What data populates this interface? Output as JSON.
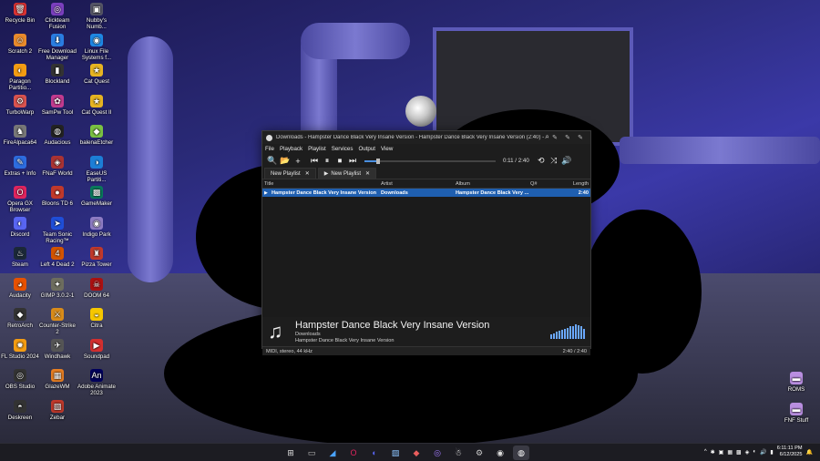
{
  "desktop": {
    "icons": [
      {
        "label": "Recycle Bin",
        "glyph": "🗑",
        "color": "#d33"
      },
      {
        "label": "Clickteam Fusion",
        "glyph": "◎",
        "color": "#7b3fbf"
      },
      {
        "label": "Nubby's Numb...",
        "glyph": "▣",
        "color": "#556"
      },
      {
        "label": "Scratch 2",
        "glyph": "☺",
        "color": "#e88a2c"
      },
      {
        "label": "Free Download Manager",
        "glyph": "⬇",
        "color": "#2a7de1"
      },
      {
        "label": "Linux File Systems f...",
        "glyph": "◉",
        "color": "#1e88e5"
      },
      {
        "label": "Paragon Partitio...",
        "glyph": "◐",
        "color": "#f39c12"
      },
      {
        "label": "Blockland",
        "glyph": "▮",
        "color": "#333"
      },
      {
        "label": "Cat Quest",
        "glyph": "★",
        "color": "#e6b422"
      },
      {
        "label": "TurboWarp",
        "glyph": "⚙",
        "color": "#d9534f"
      },
      {
        "label": "SamPw Tool",
        "glyph": "✿",
        "color": "#c23b8f"
      },
      {
        "label": "Cat Quest II",
        "glyph": "★",
        "color": "#e6b422"
      },
      {
        "label": "FireAlpaca64",
        "glyph": "♞",
        "color": "#777"
      },
      {
        "label": "Audacious",
        "glyph": "◍",
        "color": "#222"
      },
      {
        "label": "balenaEtcher",
        "glyph": "◆",
        "color": "#7ac142"
      },
      {
        "label": "Extras + Info",
        "glyph": "✎",
        "color": "#2d6cdf"
      },
      {
        "label": "FNaF World",
        "glyph": "◈",
        "color": "#a33"
      },
      {
        "label": "EaseUS Partiti...",
        "glyph": "◑",
        "color": "#1c7ed6"
      },
      {
        "label": "Opera GX Browser",
        "glyph": "O",
        "color": "#e0245e"
      },
      {
        "label": "Bloons TD 6",
        "glyph": "●",
        "color": "#c0392b"
      },
      {
        "label": "GameMaker",
        "glyph": "▩",
        "color": "#0a7a5c"
      },
      {
        "label": "Discord",
        "glyph": "◐",
        "color": "#5865f2"
      },
      {
        "label": "Team Sonic Racing™",
        "glyph": "➤",
        "color": "#1f4ed8"
      },
      {
        "label": "Indigo Park",
        "glyph": "◉",
        "color": "#8e7cc3"
      },
      {
        "label": "Steam",
        "glyph": "♨",
        "color": "#1b2838"
      },
      {
        "label": "Left 4 Dead 2",
        "glyph": "4",
        "color": "#d35400"
      },
      {
        "label": "Pizza Tower",
        "glyph": "♜",
        "color": "#c0392b"
      },
      {
        "label": "Audacity",
        "glyph": "◕",
        "color": "#e65100"
      },
      {
        "label": "GIMP 3.0.2-1",
        "glyph": "✦",
        "color": "#6d6d5e"
      },
      {
        "label": "DOOM 64",
        "glyph": "☠",
        "color": "#a11"
      },
      {
        "label": "RetroArch",
        "glyph": "◆",
        "color": "#333"
      },
      {
        "label": "Counter-Strike 2",
        "glyph": "⚔",
        "color": "#d98c1a"
      },
      {
        "label": "Citra",
        "glyph": "◒",
        "color": "#f6c700"
      },
      {
        "label": "FL Studio 2024",
        "glyph": "✹",
        "color": "#f39c12"
      },
      {
        "label": "Windhawk",
        "glyph": "✈",
        "color": "#555"
      },
      {
        "label": "Soundpad",
        "glyph": "▶",
        "color": "#d32f2f"
      },
      {
        "label": "OBS Studio",
        "glyph": "◎",
        "color": "#333"
      },
      {
        "label": "GlazeWM",
        "glyph": "▦",
        "color": "#e67e22"
      },
      {
        "label": "Adobe Animate 2023",
        "glyph": "An",
        "color": "#00005b"
      },
      {
        "label": "Deskreen",
        "glyph": "◓",
        "color": "#333"
      },
      {
        "label": "Zebar",
        "glyph": "▧",
        "color": "#c0392b"
      },
      {
        "label": "ROMS",
        "glyph": "▬",
        "color": "#b98ee0"
      },
      {
        "label": "FNF Stuff",
        "glyph": "▬",
        "color": "#b98ee0"
      }
    ]
  },
  "player": {
    "title": "Downloads - Hampster Dance Black Very Insane Version - Hampster Dance Black Very Insane Version (2:40) - Au...",
    "window_buttons": [
      "✎",
      "✎",
      "✎"
    ],
    "menu": [
      "File",
      "Playback",
      "Playlist",
      "Services",
      "Output",
      "View"
    ],
    "toolbar": {
      "search": "🔍",
      "open": "📂",
      "add": "+",
      "prev": "⏮",
      "pause": "⏸",
      "stop": "⏹",
      "next": "⏭",
      "time": "0:11 / 2:40",
      "repeat": "⟲",
      "shuffle": "⤨",
      "volume": "🔊"
    },
    "tabs": [
      {
        "label": "New Playlist",
        "close": "✕",
        "playing": false
      },
      {
        "label": "New Playlist",
        "close": "✕",
        "playing": true,
        "indicator": "▶"
      }
    ],
    "columns": {
      "title": "Title",
      "artist": "Artist",
      "album": "Album",
      "queue": "Q#",
      "length": "Length"
    },
    "rows": [
      {
        "indicator": "▶",
        "title": "Hampster Dance Black Very Insane Version",
        "artist": "Downloads",
        "album": "Hampster Dance Black Very ...",
        "queue": "",
        "length": "2:40"
      }
    ],
    "now_playing": {
      "icon": "♫",
      "title": "Hampster Dance Black Very Insane Version",
      "artist": "Downloads",
      "album": "Hampster Dance Black Very Insane Version",
      "visualizer_levels": [
        0.3,
        0.4,
        0.5,
        0.55,
        0.6,
        0.7,
        0.75,
        0.85,
        0.9,
        1.0,
        0.95,
        0.85,
        0.7
      ]
    },
    "status": {
      "left": "MIDI, stereo, 44 kHz",
      "right": "2:40 / 2:40"
    }
  },
  "taskbar": {
    "apps": [
      {
        "name": "start",
        "glyph": "⊞",
        "color": "#ddd"
      },
      {
        "name": "file-explorer",
        "glyph": "▭",
        "color": "#bbb"
      },
      {
        "name": "app-a",
        "glyph": "◢",
        "color": "#4aa3ff"
      },
      {
        "name": "opera-gx",
        "glyph": "O",
        "color": "#e0245e"
      },
      {
        "name": "discord",
        "glyph": "◐",
        "color": "#5865f2"
      },
      {
        "name": "photos",
        "glyph": "▨",
        "color": "#8cc4ff"
      },
      {
        "name": "app-b",
        "glyph": "◆",
        "color": "#e95d5d"
      },
      {
        "name": "clickteam",
        "glyph": "◎",
        "color": "#a37bff"
      },
      {
        "name": "app-c",
        "glyph": "☃",
        "color": "#eee"
      },
      {
        "name": "settings",
        "glyph": "⚙",
        "color": "#ccc"
      },
      {
        "name": "obs",
        "glyph": "◉",
        "color": "#ddd"
      },
      {
        "name": "audacious",
        "glyph": "◍",
        "color": "#fff",
        "active": true
      }
    ],
    "tray": {
      "chevron": "^",
      "icons": [
        "✱",
        "▣",
        "▦",
        "▩",
        "◈",
        "◐",
        "🔊",
        "▮"
      ],
      "time": "6:11:11 PM",
      "date": "6/12/2025",
      "bell": "🔔"
    }
  }
}
